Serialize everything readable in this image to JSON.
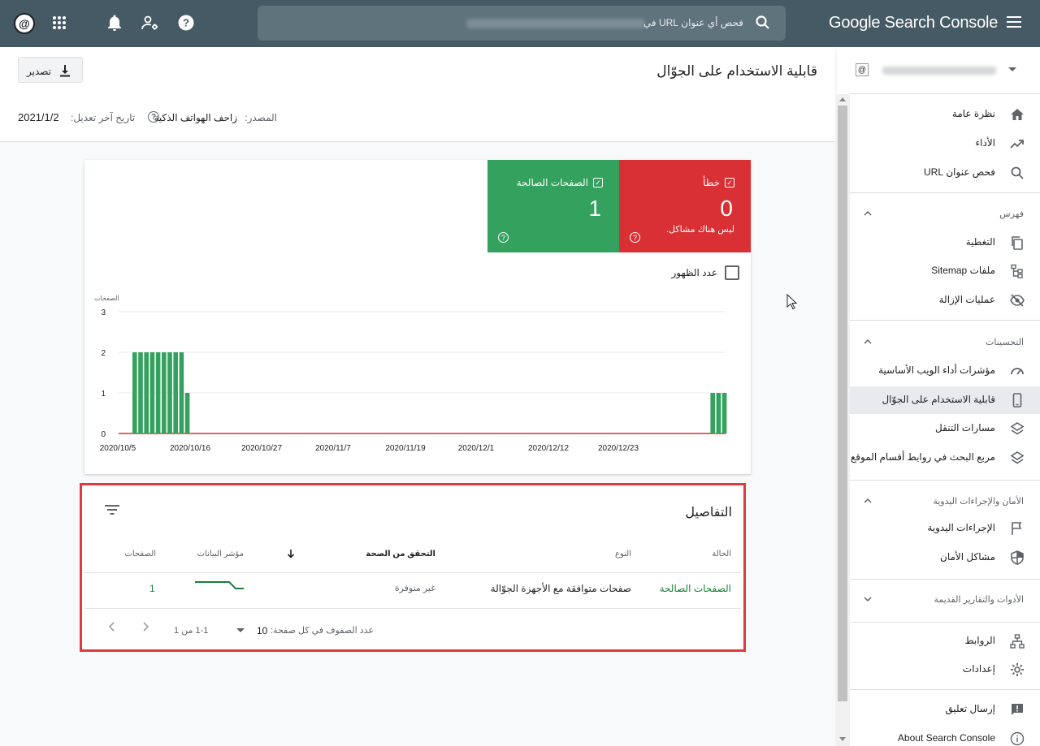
{
  "topbar": {
    "brand": "Google Search Console",
    "search_placeholder": "فحص أي عنوان URL في"
  },
  "header": {
    "title": "قابلية الاستخدام على الجوّال",
    "export_label": "تصدير"
  },
  "meta": {
    "source_label": "المصدر:",
    "source_value": "زاحف الهواتف الذكية",
    "last_updated_label": "تاريخ آخر تعديل:",
    "last_updated_value": "2021/1/2"
  },
  "tiles": {
    "error": {
      "label": "خطأ",
      "count": "0",
      "sub": "ليس هناك مشاكل.",
      "color": "#d93035"
    },
    "valid": {
      "label": "الصفحات الصالحة",
      "count": "1",
      "color": "#34a25e"
    }
  },
  "impressions_label": "عدد الظهور",
  "chart_data": {
    "type": "bar",
    "ylabel": "الصفحات",
    "ylim": [
      0,
      3
    ],
    "yticks": [
      "0",
      "1",
      "2",
      "3"
    ],
    "xticks": [
      "2020/10/5",
      "2020/10/16",
      "2020/10/27",
      "2020/11/7",
      "2020/11/19",
      "2020/12/1",
      "2020/12/12",
      "2020/12/23"
    ],
    "series": [
      {
        "color": "#34a25e",
        "values": [
          2,
          2,
          2,
          2,
          2,
          2,
          2,
          2,
          2,
          1,
          0,
          0,
          0,
          0,
          0,
          0,
          0,
          0,
          0,
          0,
          0,
          0,
          0,
          0,
          0,
          0,
          0,
          0,
          0,
          0,
          0,
          0,
          0,
          0,
          0,
          0,
          0,
          0,
          0,
          0,
          0,
          0,
          0,
          0,
          0,
          0,
          0,
          0,
          0,
          0,
          0,
          0,
          0,
          0,
          0,
          0,
          0,
          0,
          0,
          0,
          0,
          0,
          0,
          0,
          0,
          0,
          0,
          0,
          0,
          0,
          0,
          0,
          0,
          0,
          0,
          0,
          0,
          0,
          0,
          0,
          0,
          0,
          0,
          0,
          0,
          0,
          0,
          1,
          1,
          1
        ]
      },
      {
        "color": "#d93035",
        "values_all": 0
      }
    ]
  },
  "details": {
    "title": "التفاصيل",
    "columns": [
      "الحالة",
      "النوع",
      "التحقق من الصحة",
      "مؤشر البيانات",
      "الصفحات"
    ],
    "rows": [
      {
        "status": "الصفحات الصالحة",
        "type": "صفحات متوافقة مع الأجهزة الجوّالة",
        "validation": "غير متوفرة",
        "pages": "1"
      }
    ],
    "rows_per_page_label": "عدد الصفوف في كل صفحة:",
    "rows_per_page_value": "10",
    "range": "1-1 من 1"
  },
  "sidebar": {
    "items": [
      {
        "label": "نظرة عامة",
        "icon": "home-icon"
      },
      {
        "label": "الأداء",
        "icon": "trending-up-icon"
      },
      {
        "label": "فحص عنوان URL",
        "icon": "search-icon"
      }
    ],
    "sections": [
      {
        "title": "فهرس",
        "items": [
          {
            "label": "التغطية",
            "icon": "copy-icon"
          },
          {
            "label": "ملفات Sitemap",
            "icon": "sitemap-icon"
          },
          {
            "label": "عمليات الإزالة",
            "icon": "eye-off-icon"
          }
        ]
      },
      {
        "title": "التحسينات",
        "items": [
          {
            "label": "مؤشرات أداء الويب الأساسية",
            "icon": "speed-icon"
          },
          {
            "label": "قابلية الاستخدام على الجوّال",
            "icon": "phone-icon"
          },
          {
            "label": "مسارات التنقل",
            "icon": "layers-icon"
          },
          {
            "label": "مربع البحث في روابط أقسام الموقع",
            "icon": "layers-icon"
          }
        ]
      },
      {
        "title": "الأمان والإجراءات اليدوية",
        "items": [
          {
            "label": "الإجراءات اليدوية",
            "icon": "flag-icon"
          },
          {
            "label": "مشاكل الأمان",
            "icon": "shield-icon"
          }
        ]
      },
      {
        "title": "الأدوات والتقارير القديمة",
        "items": []
      }
    ],
    "bottom": [
      {
        "label": "الروابط",
        "icon": "links-icon"
      },
      {
        "label": "إعدادات",
        "icon": "gear-icon"
      },
      {
        "label": "إرسال تعليق",
        "icon": "feedback-icon"
      },
      {
        "label": "About Search Console",
        "icon": "info-icon"
      }
    ]
  }
}
